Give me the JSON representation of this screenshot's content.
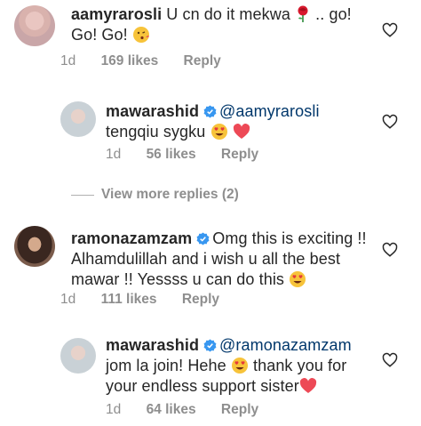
{
  "comments": [
    {
      "username": "aamyrarosli",
      "text_a": "U cn do it mekwa",
      "text_b": ".. go!",
      "text_c": "Go! Go!",
      "time": "1d",
      "likes": "169 likes",
      "reply": "Reply"
    },
    {
      "username": "mawarashid",
      "mention": "@aamyrarosli",
      "text_a": "tengqiu sygku",
      "time": "1d",
      "likes": "56 likes",
      "reply": "Reply"
    },
    {
      "username": "ramonazamzam",
      "line1": "Omg this is exciting !!",
      "line2": "Alhamdulillah and i wish u all the best",
      "line3": "mawar !! Yessss u can do this",
      "time": "1d",
      "likes": "111 likes",
      "reply": "Reply"
    },
    {
      "username": "mawarashid",
      "mention": "@ramonazamzam",
      "line2a": "jom la join! Hehe",
      "line2b": "thank you for",
      "line3": "your endless support sister",
      "time": "1d",
      "likes": "64 likes",
      "reply": "Reply"
    }
  ],
  "view_more": "View more replies (2)",
  "icons": [
    "heart-outline-icon",
    "verified-badge-icon",
    "rose-emoji",
    "kiss-emoji",
    "heart-eyes-emoji",
    "red-heart-emoji"
  ],
  "colors": {
    "username": "#262626",
    "mention": "#00376b",
    "meta": "#8e8e8e",
    "verified": "#3897f0",
    "heart_emoji": "#ed4956"
  }
}
